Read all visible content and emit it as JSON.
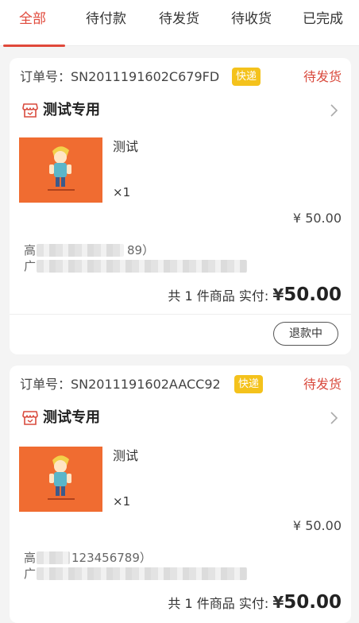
{
  "tabs": [
    {
      "label": "全部",
      "active": true
    },
    {
      "label": "待付款",
      "active": false
    },
    {
      "label": "待发货",
      "active": false
    },
    {
      "label": "待收货",
      "active": false
    },
    {
      "label": "已完成",
      "active": false
    }
  ],
  "orders": [
    {
      "order_no": "订单号：SN2011191602C679FD",
      "badge": "快递",
      "status": "待发货",
      "shop_name": "测试专用",
      "item_title": "测试",
      "item_qty": "×1",
      "item_price": "¥ 50.00",
      "addr_line1": "高",
      "addr_line1_tail": "89）",
      "addr_line2": "广",
      "total_prefix": "共 1 件商品 实付: ",
      "total_symbol": "¥",
      "total_amount": "50.00",
      "action_label": "退款中"
    },
    {
      "order_no": "订单号：SN2011191602AACC92",
      "badge": "快递",
      "status": "待发货",
      "shop_name": "测试专用",
      "item_title": "测试",
      "item_qty": "×1",
      "item_price": "¥ 50.00",
      "addr_line1": "高",
      "addr_line1_tail": "123456789）",
      "addr_line2": "广",
      "total_prefix": "共 1 件商品 实付: ",
      "total_symbol": "¥",
      "total_amount": "50.00"
    }
  ],
  "colors": {
    "accent": "#e0483a",
    "status": "#d94a3d",
    "badge": "#f4c21c",
    "thumb_bg": "#f06c31"
  },
  "icons": [
    "shop-icon",
    "chevron-right-icon"
  ]
}
